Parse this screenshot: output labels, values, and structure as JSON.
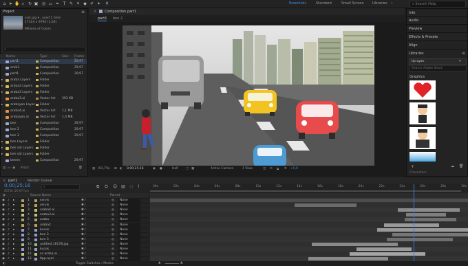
{
  "toolbar": {
    "workspaces": [
      "Essentials",
      "Standard",
      "Small Screen",
      "Libraries"
    ],
    "search_placeholder": "Search Help"
  },
  "project": {
    "tab": "Project",
    "info_line1": "ssst.jpg ▾ , used 1 time",
    "info_line2": "17324 x 9794 (1,00)",
    "info_line3": "Millions of Colors",
    "search_placeholder": "",
    "columns": [
      "Name",
      "Type",
      "Size",
      "Frame R..."
    ],
    "items": [
      {
        "name": "part1",
        "type": "Composition",
        "size": "",
        "fr": "29,97",
        "icon": "#a0a9d6",
        "label": "#c9b64f"
      },
      {
        "name": "arab3",
        "type": "Composition",
        "size": "",
        "fr": "29,97",
        "icon": "#a0a9d6",
        "label": "#c9b64f"
      },
      {
        "name": "part1",
        "type": "Composition",
        "size": "",
        "fr": "29,97",
        "icon": "#a0a9d6",
        "label": "#c9b64f"
      },
      {
        "name": "araba Layers",
        "type": "Folder",
        "size": "",
        "fr": "",
        "icon": "#d9b85c",
        "label": "#c9b64f"
      },
      {
        "name": "araba2 Layers",
        "type": "Folder",
        "size": "",
        "fr": "",
        "icon": "#d9b85c",
        "label": "#c9b64f"
      },
      {
        "name": "araba3 Layers",
        "type": "Folder",
        "size": "",
        "fr": "",
        "icon": "#d9b85c",
        "label": "#c9b64f"
      },
      {
        "name": "araba3.ai",
        "type": "Vector Art",
        "size": "393 KB",
        "fr": "",
        "icon": "#e8923a",
        "label": "#b38a5a"
      },
      {
        "name": "arabayan Layers",
        "type": "Folder",
        "size": "",
        "fr": "",
        "icon": "#d9b85c",
        "label": "#c9b64f"
      },
      {
        "name": "araba4.ai",
        "type": "Vector Art",
        "size": "1,1 MB",
        "fr": "",
        "icon": "#e8923a",
        "label": "#b38a5a"
      },
      {
        "name": "arabayan.ai",
        "type": "Vector Art",
        "size": "1,4 MB",
        "fr": "",
        "icon": "#e8923a",
        "label": "#b38a5a"
      },
      {
        "name": "ben",
        "type": "Composition",
        "size": "",
        "fr": "29,97",
        "icon": "#a0a9d6",
        "label": "#c9b64f"
      },
      {
        "name": "ben 2",
        "type": "Composition",
        "size": "",
        "fr": "29,97",
        "icon": "#a0a9d6",
        "label": "#c9b64f"
      },
      {
        "name": "ben 3",
        "type": "Composition",
        "size": "",
        "fr": "29,97",
        "icon": "#a0a9d6",
        "label": "#c9b64f"
      },
      {
        "name": "ben Layers",
        "type": "Folder",
        "size": "",
        "fr": "",
        "icon": "#d9b85c",
        "label": "#c9b64f"
      },
      {
        "name": "ben sat Layers",
        "type": "Folder",
        "size": "",
        "fr": "",
        "icon": "#d9b85c",
        "label": "#c9b64f"
      },
      {
        "name": "ben sat Layers",
        "type": "Folder",
        "size": "",
        "fr": "",
        "icon": "#d9b85c",
        "label": "#c9b64f"
      },
      {
        "name": "benen",
        "type": "Composition",
        "size": "",
        "fr": "29,97",
        "icon": "#a0a9d6",
        "label": "#c9b64f"
      }
    ],
    "footer_bpc": "8 bpc"
  },
  "composition": {
    "tab": "Composition part1",
    "sub_tabs": [
      "part1",
      "ben 2"
    ],
    "zoom": "(93,7%)",
    "timecode": "0;00;25;16",
    "resolution": "Half",
    "camera": "Active Camera",
    "views": "1 View",
    "exposure": "+0,0"
  },
  "right": {
    "items": [
      "Info",
      "Audio",
      "Preview",
      "Effects & Presets",
      "Align",
      "Libraries"
    ],
    "library_name": "tip-ayan",
    "library_search": "Search Adobe Stock",
    "graphics_label": "Graphics",
    "characters_label": "Characters"
  },
  "timeline": {
    "tabs": [
      "part1",
      "Render Queue"
    ],
    "time": "0;00;25;16",
    "time_sub": "00766 (29,97 fps)",
    "columns": [
      "Source Name",
      "Parent"
    ],
    "ticks": [
      "00s",
      "02s",
      "04s",
      "06s",
      "08s",
      "10s",
      "12s",
      "14s",
      "16s",
      "18s",
      "20s",
      "22s",
      "24s",
      "26s",
      "28s",
      "30s"
    ],
    "footer": "Toggle Switches / Modes",
    "layers": [
      {
        "n": "1",
        "name": "servis",
        "parent": "None",
        "color": "#b6a05a"
      },
      {
        "n": "2",
        "name": "servis",
        "parent": "None",
        "color": "#b6a05a"
      },
      {
        "n": "3",
        "name": "araba4.ai",
        "parent": "None",
        "color": "#c7c27a"
      },
      {
        "n": "4",
        "name": "araba3.ai",
        "parent": "None",
        "color": "#c7c27a"
      },
      {
        "n": "5",
        "name": "araba",
        "parent": "None",
        "color": "#b6a05a"
      },
      {
        "n": "6",
        "name": "araba2",
        "parent": "None",
        "color": "#b6a05a"
      },
      {
        "n": "7",
        "name": "kucuk",
        "parent": "None",
        "color": "#8f9fd0"
      },
      {
        "n": "8",
        "name": "ben 3",
        "parent": "None",
        "color": "#8f9fd0"
      },
      {
        "n": "9",
        "name": "ben 3",
        "parent": "None",
        "color": "#8f9fd0"
      },
      {
        "n": "10",
        "name": "untitled.16178.jpg",
        "parent": "None",
        "color": "#a3b58a"
      },
      {
        "n": "11",
        "name": "kucuk",
        "parent": "None",
        "color": "#8f9fd0"
      },
      {
        "n": "12",
        "name": "so araba.ai",
        "parent": "None",
        "color": "#c7c27a"
      },
      {
        "n": "13",
        "name": "tipp-ayal",
        "parent": "None",
        "color": "#8f9fd0"
      },
      {
        "n": "14",
        "name": "ssst.jpg",
        "parent": "None",
        "color": "#a3b58a"
      }
    ]
  }
}
